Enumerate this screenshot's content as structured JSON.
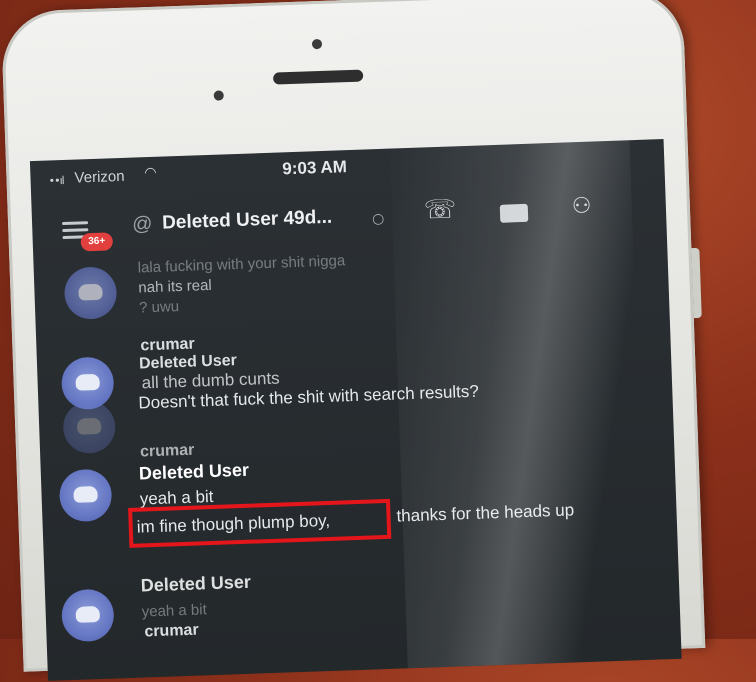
{
  "status_bar": {
    "signal": "••ıl",
    "carrier": "Verizon",
    "wifi_icon": "wifi-icon",
    "time": "9:03 AM"
  },
  "header": {
    "unread_badge": "36+",
    "at_symbol": "@",
    "title": "Deleted User 49d...",
    "status_indicator": "○"
  },
  "messages": {
    "ghost_top_1": "lala fucking with your shit nigga",
    "ghost_top_2": "nah its real",
    "ghost_top_3": "? uwu",
    "group1_name": "crumar",
    "group1_subname": "Deleted User",
    "group1_line1": "all the dumb cunts",
    "group1_line2": "Doesn't that fuck the shit with search results?",
    "group2_name": "crumar",
    "group2_subname": "Deleted User",
    "group2_line1": "yeah a bit",
    "group2_line2_highlight": "im fine though plump boy,",
    "group2_line2_rest": "thanks for the heads up",
    "group3_subname": "Deleted User",
    "group3_line1": "yeah a bit",
    "group4_name": "crumar"
  },
  "colors": {
    "highlight_border": "#e4161c",
    "badge_bg": "#e2403e",
    "avatar": "#6677c4"
  }
}
